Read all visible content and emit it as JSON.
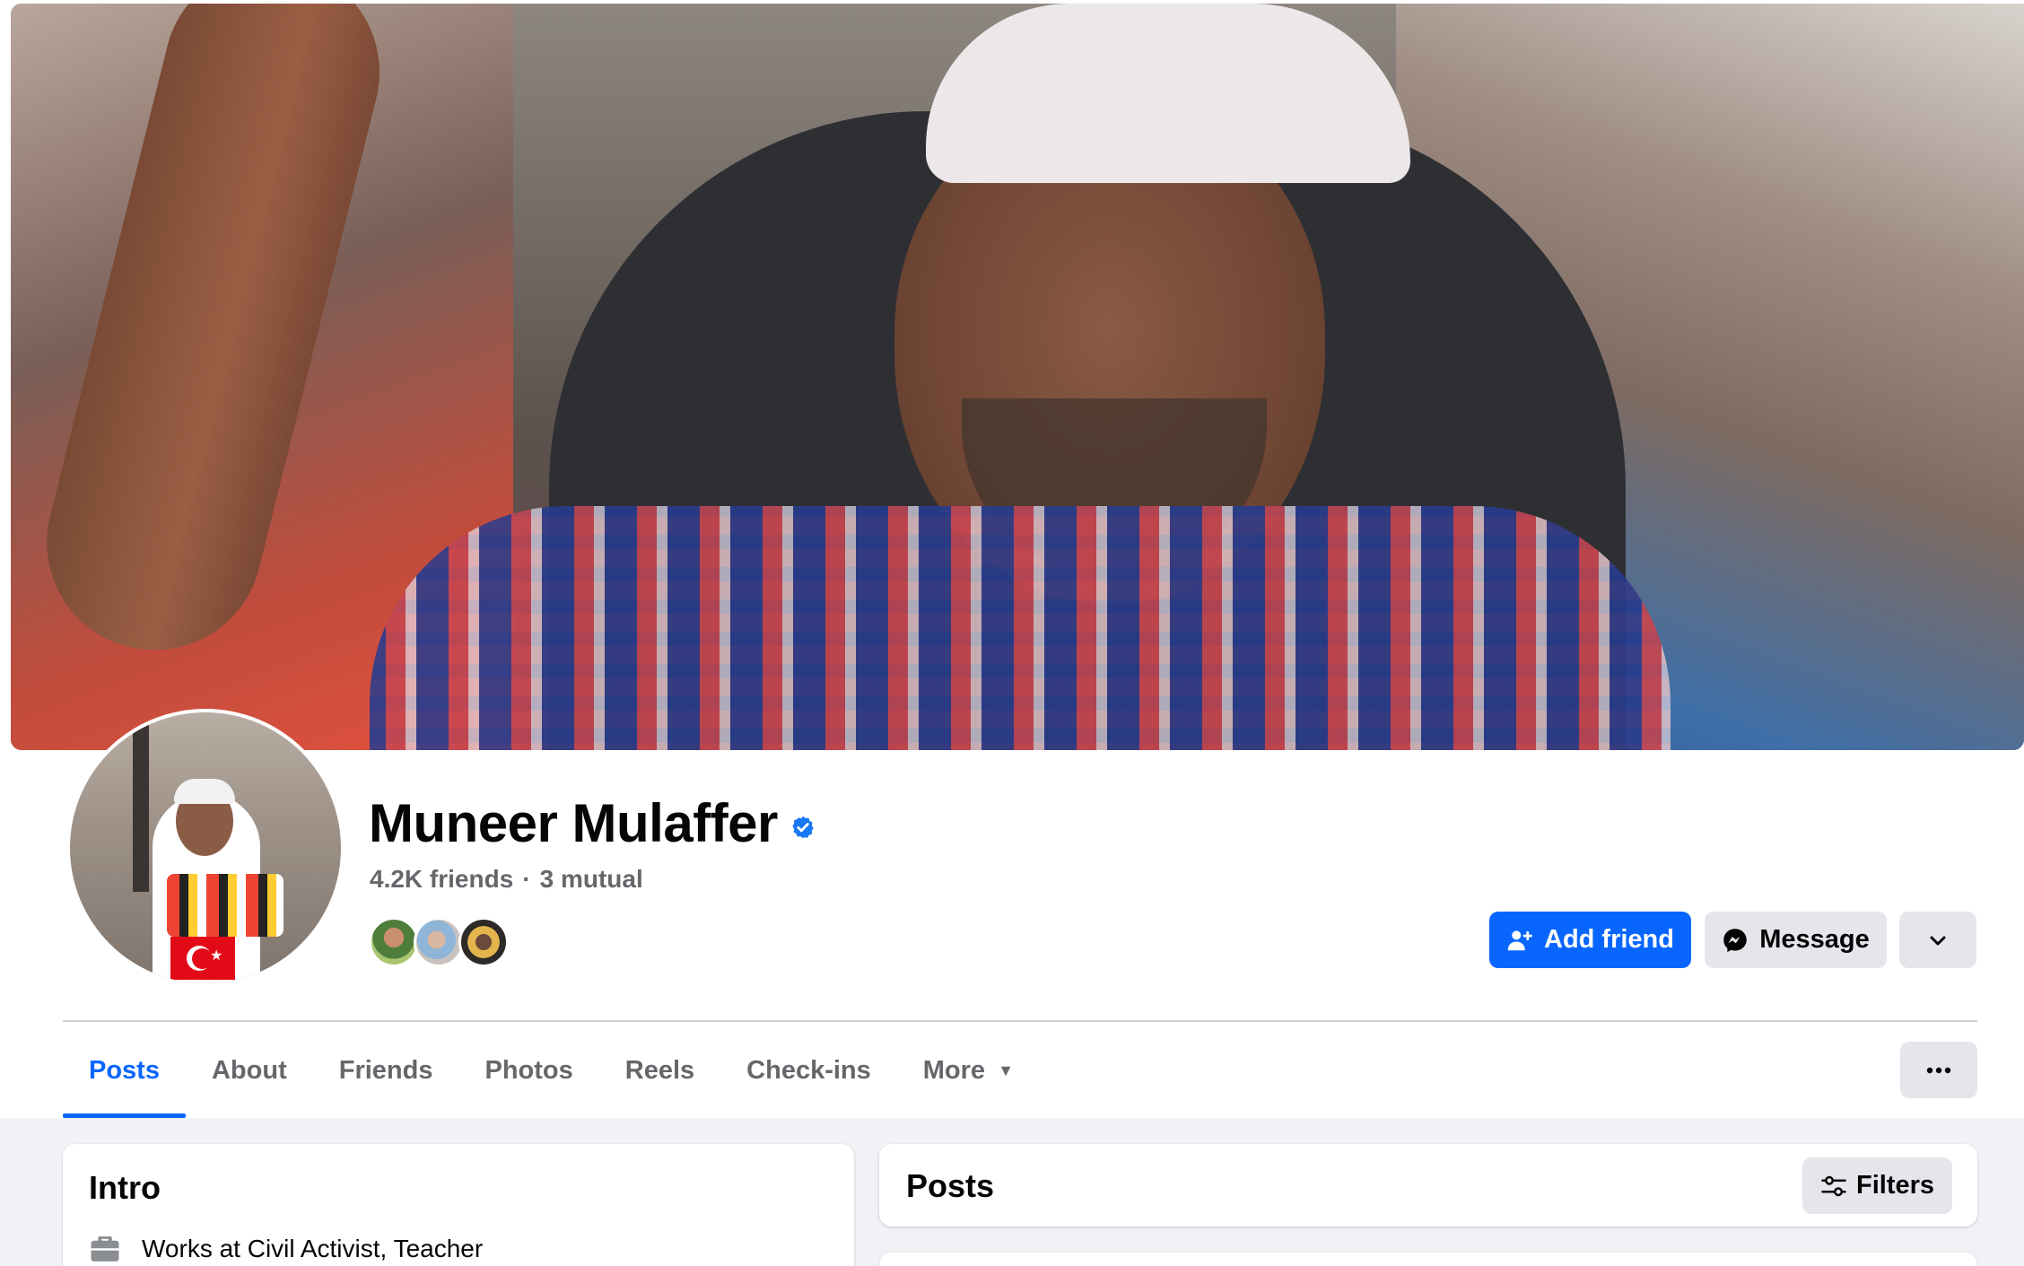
{
  "profile": {
    "name": "Muneer Mulaffer",
    "verified": true,
    "friends_count": "4.2K friends",
    "mutual": "3 mutual",
    "separator": "·"
  },
  "actions": {
    "add_friend_label": "Add friend",
    "message_label": "Message"
  },
  "tabs": [
    {
      "label": "Posts",
      "active": true
    },
    {
      "label": "About"
    },
    {
      "label": "Friends"
    },
    {
      "label": "Photos"
    },
    {
      "label": "Reels"
    },
    {
      "label": "Check-ins"
    },
    {
      "label": "More"
    }
  ],
  "intro": {
    "title": "Intro",
    "work": "Works at Civil Activist, Teacher"
  },
  "posts": {
    "title": "Posts",
    "filters_label": "Filters"
  },
  "colors": {
    "accent": "#0866ff",
    "secondary_button": "#e4e6eb",
    "background": "#f0f2f5",
    "muted_text": "#65676b",
    "verified": "#1877f2"
  },
  "icons": [
    "verified-badge-icon",
    "add-friend-icon",
    "messenger-icon",
    "chevron-down-icon",
    "caret-down-icon",
    "more-dots-icon",
    "filters-icon",
    "briefcase-icon"
  ]
}
